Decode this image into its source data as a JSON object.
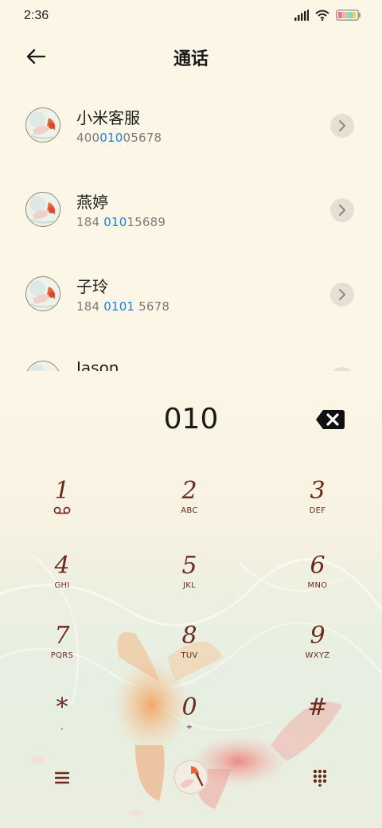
{
  "status": {
    "time": "2:36",
    "icons": [
      "signal-icon",
      "wifi-icon",
      "battery-icon"
    ]
  },
  "header": {
    "title": "通话",
    "back_icon": "arrow-left-icon"
  },
  "contacts": [
    {
      "name": "小米客服",
      "number_pre": "400",
      "number_hl": "010",
      "number_post": "05678"
    },
    {
      "name": "燕婷",
      "number_pre": "184 ",
      "number_hl": "010",
      "number_post": "15689"
    },
    {
      "name": "子玲",
      "number_pre": "184 ",
      "number_hl": "0101",
      "number_post": " 5678"
    },
    {
      "name": "Jason",
      "number_pre": "",
      "number_hl": "",
      "number_post": ""
    }
  ],
  "dialer": {
    "number": "010",
    "keys": [
      {
        "digit": "1",
        "letters": "⌴⌴"
      },
      {
        "digit": "2",
        "letters": "ABC"
      },
      {
        "digit": "3",
        "letters": "DEF"
      },
      {
        "digit": "4",
        "letters": "GHI"
      },
      {
        "digit": "5",
        "letters": "JKL"
      },
      {
        "digit": "6",
        "letters": "MNO"
      },
      {
        "digit": "7",
        "letters": "PQRS"
      },
      {
        "digit": "8",
        "letters": "TUV"
      },
      {
        "digit": "9",
        "letters": "WXYZ"
      },
      {
        "digit": "*",
        "letters": ","
      },
      {
        "digit": "0",
        "letters": "+"
      },
      {
        "digit": "#",
        "letters": ""
      }
    ]
  },
  "colors": {
    "background": "#fcf6e6",
    "highlight": "#1f7ee0",
    "key_text": "#6b2a1c"
  }
}
